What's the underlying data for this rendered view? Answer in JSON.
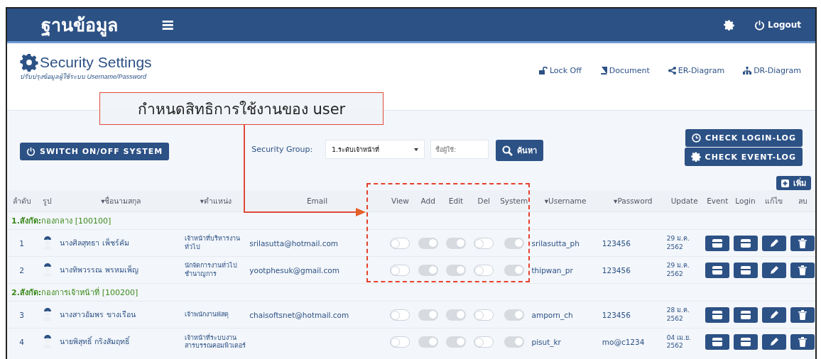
{
  "navbar": {
    "brand": "ฐานข้อมูล",
    "menu_icon": "≡",
    "logout": "Logout"
  },
  "page_header": {
    "title": "Security Settings",
    "subtitle": "ปรับปรุงข้อมูลผู้ใช้ระบบ Username/Password",
    "links": [
      "Lock Off",
      "Document",
      "ER-Diagram",
      "DR-Diagram"
    ]
  },
  "toolbar": {
    "switch_button": "SWITCH ON/OFF SYSTEM",
    "group_label": "Security Group:",
    "group_select": "1.ระดับเจ้าหน้าที่",
    "user_field": {
      "placeholder": "ชื่อผู้ใช้:"
    },
    "search_button": "ค้นหา",
    "login_log_button": "CHECK LOGIN-LOG",
    "event_log_button": "CHECK EVENT-LOG",
    "add_button": "เพิ่ม"
  },
  "table": {
    "columns": [
      "ลำดับ",
      "รูป",
      "▾ชื่อนามสกุล",
      "▾ตำแหน่ง",
      "Email",
      "View",
      "Add",
      "Edit",
      "Del",
      "System",
      "▾Username",
      "▾Password",
      "Update",
      "Event",
      "Login",
      "แก้ไข",
      "ลบ"
    ],
    "rows": [
      {
        "kind": "group",
        "label": "**1.สังกัด:**กองกลาง [100100]"
      },
      {
        "kind": "user",
        "no": "1",
        "name": "นางศิลสุทธา เพ็ชร์คัม",
        "position": "เจ้าหน้าที่บริหารงานทั่วไป",
        "email": "srilasutta@hotmail.com",
        "perms": [
          false,
          true,
          true,
          false,
          true
        ],
        "username": "srilasutta_ph",
        "password": "123456",
        "update": "29 ม.ค. 2562"
      },
      {
        "kind": "user",
        "no": "2",
        "name": "นางทิพวรรณ พรหมเพ็ญ",
        "position": "นักจัดการงานทั่วไปชำนาญการ",
        "email": "yootphesuk@gmail.com",
        "perms": [
          false,
          true,
          true,
          false,
          true
        ],
        "username": "thipwan_pr",
        "password": "123456",
        "update": "29 ม.ค. 2562"
      },
      {
        "kind": "group",
        "label": "**2.สังกัด:**กองการเจ้าหน้าที่ [100200]"
      },
      {
        "kind": "user",
        "no": "3",
        "name": "นางสาวอัมพร ขางเรือน",
        "position": "เจ้าพนักงานพัสดุ",
        "email": "chaisoftsnet@hotmail.com",
        "perms": [
          false,
          true,
          true,
          false,
          true
        ],
        "username": "amporn_ch",
        "password": "123456",
        "update": "28 ม.ค. 2562"
      },
      {
        "kind": "user",
        "no": "4",
        "name": "นายพิสุทธิ์ กริงสัมฤทธิ์",
        "position": "เจ้าหน้าที่ระบบงานสารบรรณคอมพิวเตอร์",
        "email": "",
        "perms": [
          false,
          true,
          true,
          false,
          true
        ],
        "username": "pisut_kr",
        "password": "mo@c1234",
        "update": "04 เม.ย. 2562"
      }
    ]
  },
  "annotation": {
    "callout": "กำหนดสิทธิการใช้งานของ user"
  }
}
